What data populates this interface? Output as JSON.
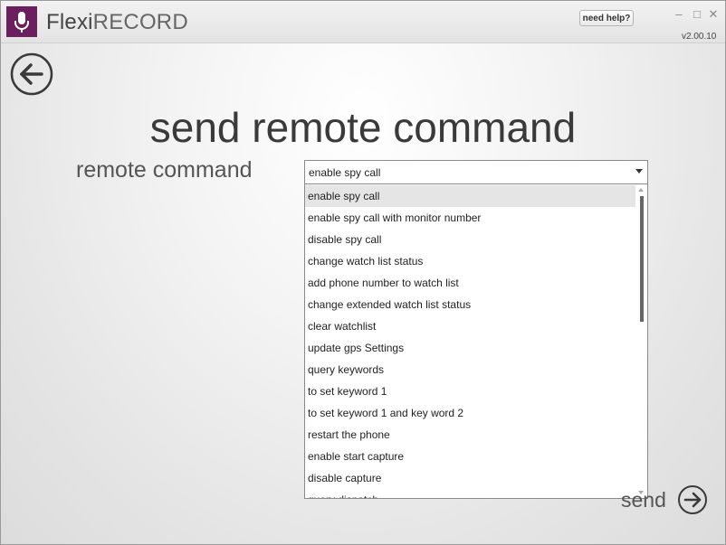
{
  "app": {
    "title_part1": "Flexi",
    "title_part2": "RECORD",
    "version": "v2.00.10",
    "help_label": "need help?",
    "brand_color": "#6b1f5e",
    "logo_icon": "microphone-icon"
  },
  "window_controls": {
    "minimize": "–",
    "maximize": "□",
    "close": "✕"
  },
  "page": {
    "title": "send remote command",
    "field_label": "remote command",
    "back_icon": "arrow-left-circle-icon"
  },
  "select": {
    "value": "enable spy call",
    "options": [
      "enable spy call",
      "enable spy call with monitor number",
      "disable spy call",
      "change watch list status",
      "add phone number to watch list",
      "change extended watch list status",
      "clear watchlist",
      "update gps Settings",
      "query keywords",
      "to set keyword 1",
      "to set keyword 1 and key word 2",
      "restart the phone",
      "enable start capture",
      "disable capture",
      "query dispatch"
    ],
    "highlighted_index": 0
  },
  "send": {
    "label": "send",
    "icon": "arrow-right-circle-icon"
  }
}
